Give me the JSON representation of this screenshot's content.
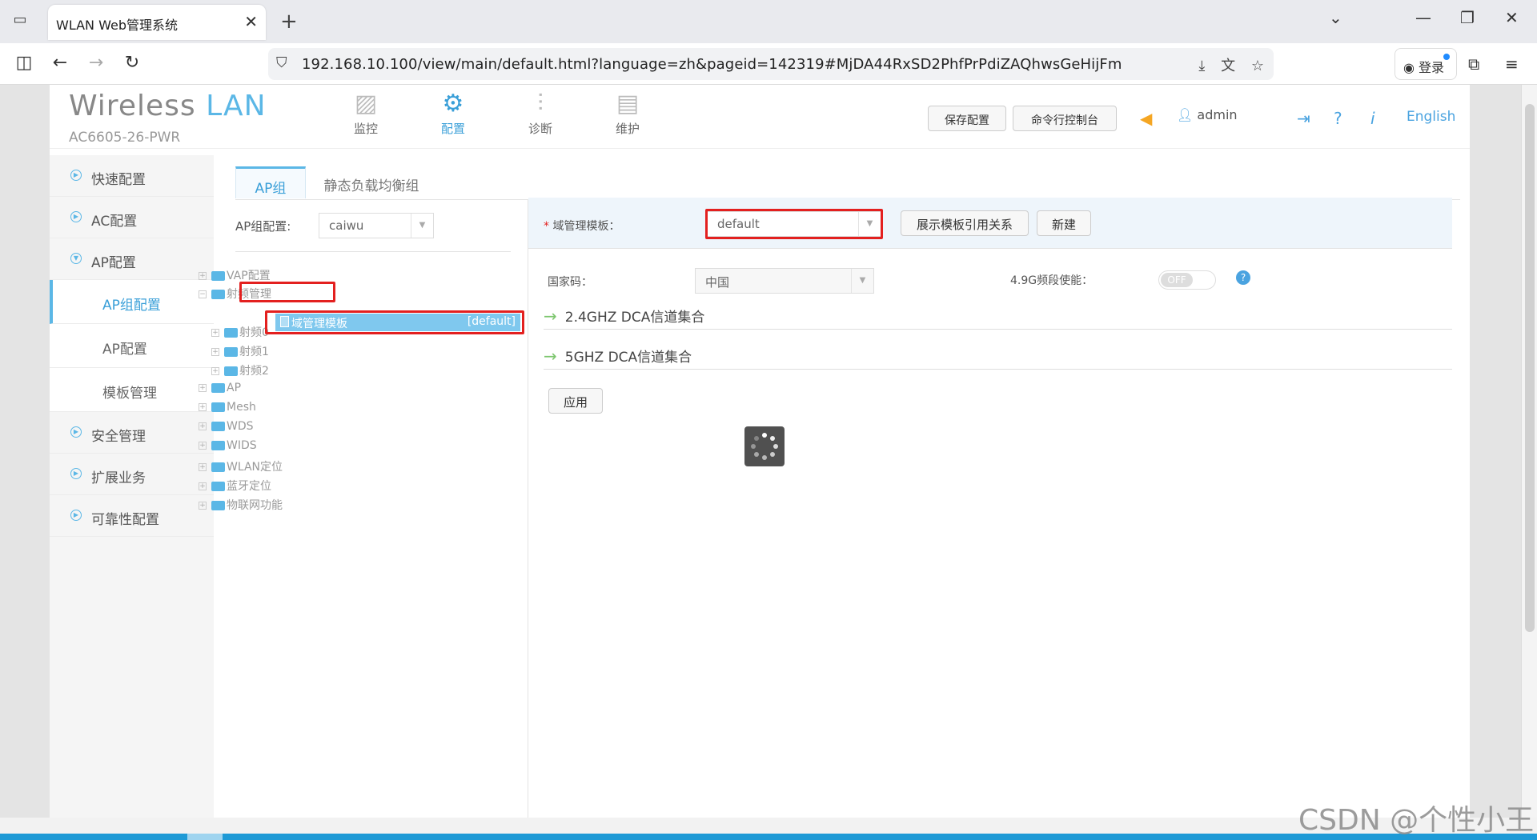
{
  "browser": {
    "tab_title": "WLAN Web管理系统",
    "url": "192.168.10.100/view/main/default.html?language=zh&pageid=142319#MjDA44RxSD2PhfPrPdiZAQhwsGeHijFm",
    "login_label": "登录"
  },
  "header": {
    "logo_main": "Wireless",
    "logo_accent": "LAN",
    "model": "AC6605-26-PWR",
    "nav": [
      "监控",
      "配置",
      "诊断",
      "维护"
    ],
    "save_config": "保存配置",
    "cli_console": "命令行控制台",
    "user": "admin",
    "language": "English"
  },
  "sidebar": {
    "items": [
      "快速配置",
      "AC配置",
      "AP配置"
    ],
    "sub_items": [
      "AP组配置",
      "AP配置",
      "模板管理"
    ],
    "items_after": [
      "安全管理",
      "扩展业务",
      "可靠性配置"
    ]
  },
  "content": {
    "tabs": [
      "AP组",
      "静态负载均衡组"
    ],
    "ap_group_label": "AP组配置:",
    "ap_group_value": "caiwu",
    "tree": {
      "vap": "VAP配置",
      "radio_mgmt": "射频管理",
      "domain_template": "域管理模板",
      "domain_template_tag": "[default]",
      "radio0": "射频0",
      "radio1": "射频1",
      "radio2": "射频2",
      "ap": "AP",
      "mesh": "Mesh",
      "wds": "WDS",
      "wids": "WIDS",
      "wlan_loc": "WLAN定位",
      "bt_loc": "蓝牙定位",
      "iot": "物联网功能"
    },
    "form": {
      "domain_template_label": "域管理模板：",
      "domain_template_value": "default",
      "show_ref_button": "展示模板引用关系",
      "new_button": "新建",
      "country_label": "国家码：",
      "country_value": "中国",
      "band49_label": "4.9G频段使能：",
      "band49_state": "OFF",
      "dca_24": "2.4GHZ DCA信道集合",
      "dca_5": "5GHZ DCA信道集合",
      "apply_button": "应用"
    }
  },
  "watermark": "CSDN @个性小王"
}
